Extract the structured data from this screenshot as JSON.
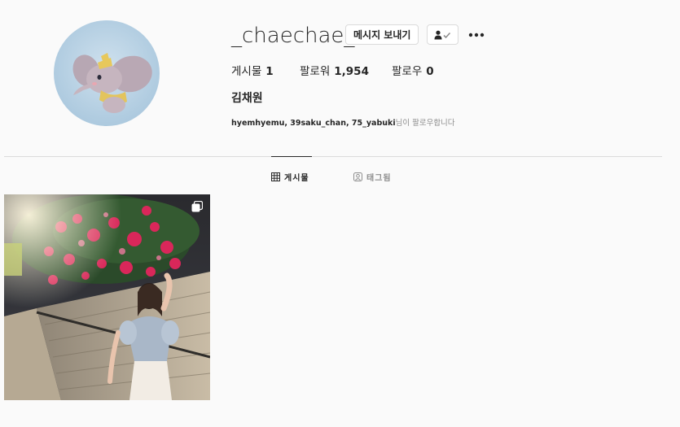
{
  "profile": {
    "username": "_chaechae_1",
    "full_name": "김채원",
    "avatar_icon": "dumbo-elephant-avatar"
  },
  "actions": {
    "message_label": "메시지 보내기",
    "follow_icon": "person-check-icon",
    "more_icon": "more-dots-icon"
  },
  "stats": {
    "posts_label": "게시물",
    "posts_count": "1",
    "followers_label": "팔로워",
    "followers_count": "1,954",
    "following_label": "팔로우",
    "following_count": "0"
  },
  "followed_by": {
    "users": "hyemhyemu, 39saku_chan, 75_yabuki",
    "suffix": "님이 팔로우합니다"
  },
  "tabs": [
    {
      "label": "게시물",
      "icon": "grid-icon",
      "active": true
    },
    {
      "label": "태그됨",
      "icon": "tag-person-icon",
      "active": false
    }
  ],
  "posts": [
    {
      "type": "carousel",
      "icon": "multiple-images-icon"
    }
  ],
  "colors": {
    "background": "#fafafa",
    "text": "#262626",
    "muted": "#8e8e8e",
    "border": "#dbdbdb",
    "avatar_bg": "#b9d3e6"
  }
}
